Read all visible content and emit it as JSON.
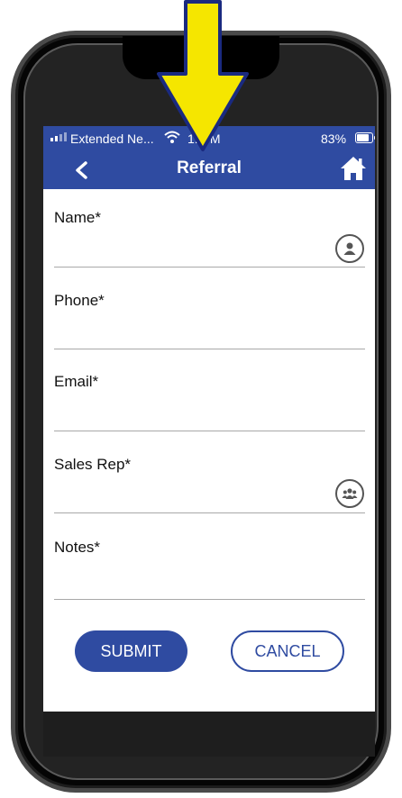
{
  "status_bar": {
    "carrier": "Extended Ne...",
    "time": "1:  PM",
    "battery": "83%"
  },
  "nav": {
    "title": "Referral",
    "back_icon": "chevron-left-icon",
    "home_icon": "home-icon"
  },
  "form": {
    "fields": [
      {
        "label": "Name*",
        "icon": "contact-person-icon"
      },
      {
        "label": "Phone*"
      },
      {
        "label": "Email*"
      },
      {
        "label": "Sales Rep*",
        "icon": "group-people-icon"
      },
      {
        "label": "Notes*"
      }
    ]
  },
  "buttons": {
    "submit": "SUBMIT",
    "cancel": "CANCEL"
  },
  "colors": {
    "primary": "#2f4ba1",
    "arrow_fill": "#f5e600",
    "arrow_outline": "#1a2a80"
  }
}
